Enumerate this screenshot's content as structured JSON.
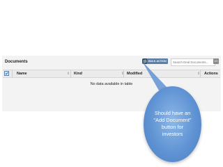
{
  "header": {
    "title": "Documents"
  },
  "toolbar": {
    "gear_icon": "gear-icon",
    "bulk_action_label": "BULK ACTION",
    "search_placeholder": "Search Deal Documents...",
    "go_label": "GO"
  },
  "table": {
    "columns": [
      {
        "label": "Name"
      },
      {
        "label": "Kind"
      },
      {
        "label": "Modified"
      },
      {
        "label": "Actions"
      }
    ],
    "empty_message": "No data available in table"
  },
  "callout": {
    "text": "Should have an \"Add Document\" button for investors",
    "color": "#5f93d3"
  }
}
